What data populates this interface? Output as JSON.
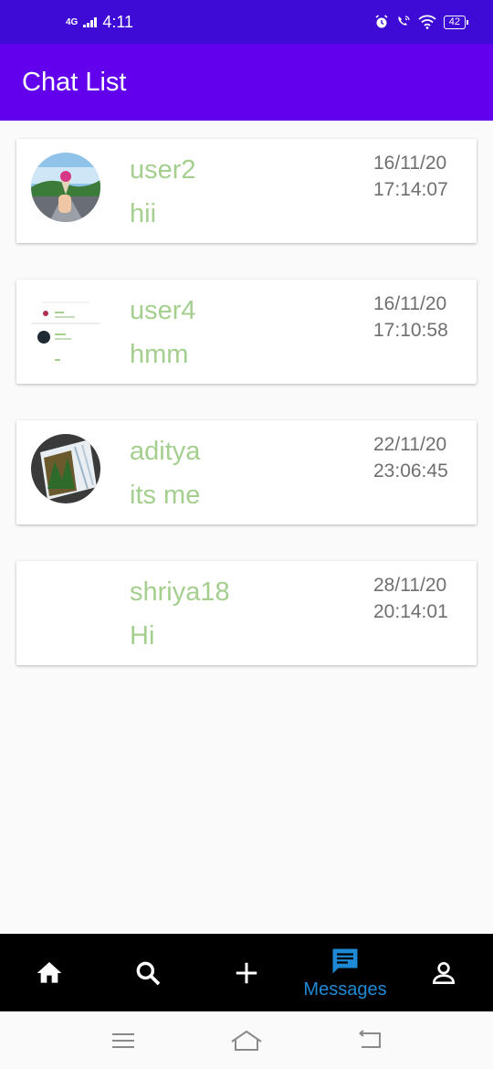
{
  "status_bar": {
    "network": "4G",
    "time": "4:11",
    "battery": "42"
  },
  "app_bar": {
    "title": "Chat List"
  },
  "chats": [
    {
      "name": "user2",
      "message": "hii",
      "date": "16/11/20",
      "time": "17:14:07",
      "avatar": "photo-ice-cream"
    },
    {
      "name": "user4",
      "message": "hmm",
      "date": "16/11/20",
      "time": "17:10:58",
      "avatar": "screenshot-thumbnail"
    },
    {
      "name": "aditya",
      "message": "its me",
      "date": "22/11/20",
      "time": "23:06:45",
      "avatar": "photo-building"
    },
    {
      "name": "shriya18",
      "message": "Hi",
      "date": "28/11/20",
      "time": "20:14:01",
      "avatar": "none"
    }
  ],
  "bottom_nav": {
    "items": [
      {
        "icon": "home-icon"
      },
      {
        "icon": "search-icon"
      },
      {
        "icon": "add-icon"
      },
      {
        "icon": "message-icon",
        "label": "Messages",
        "active": true
      },
      {
        "icon": "person-icon"
      }
    ],
    "active_color": "#1e8ad6"
  },
  "colors": {
    "status_bar": "#3e0ad6",
    "app_bar": "#6200ee",
    "chat_text": "#a5cf8e"
  }
}
